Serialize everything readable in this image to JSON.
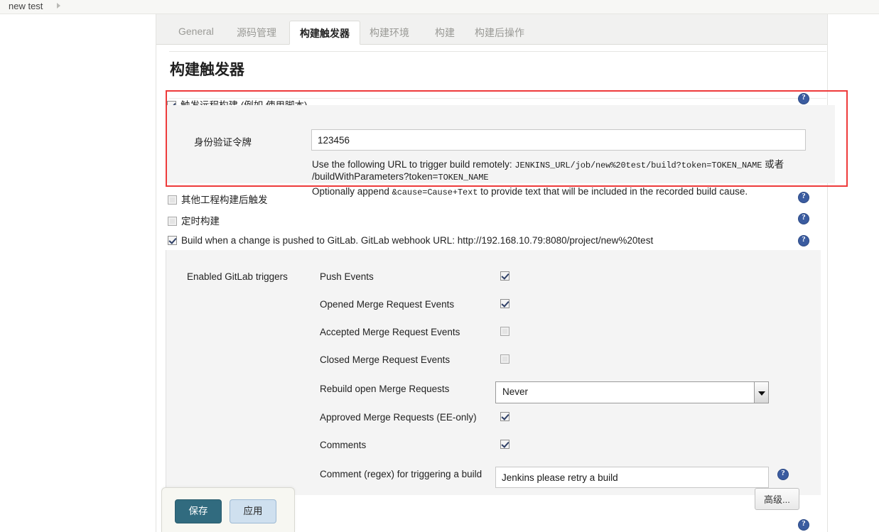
{
  "breadcrumb": {
    "item": "new test",
    "arrow_icon": "chevron-right-icon"
  },
  "tabs": [
    {
      "label": "General",
      "active": false
    },
    {
      "label": "源码管理",
      "active": false
    },
    {
      "label": "构建触发器",
      "active": true
    },
    {
      "label": "构建环境",
      "active": false
    },
    {
      "label": "构建",
      "active": false
    },
    {
      "label": "构建后操作",
      "active": false
    }
  ],
  "section": {
    "title": "构建触发器"
  },
  "remote_trigger": {
    "checkbox_label": "触发远程构建 (例如,使用脚本)",
    "checked": true,
    "highlighted": true,
    "highlight_color": "#ee3b3b",
    "token_label": "身份验证令牌",
    "token_value": "123456",
    "help_line1_a": "Use the following URL to trigger build remotely:",
    "help_line1_mono": "JENKINS_URL/job/new%20test/build?token=TOKEN_NAME",
    "help_line1_b": "或者",
    "help_line2_a": "/buildWithParameters?token=",
    "help_line2_mono": "TOKEN_NAME",
    "help_line3_a": "Optionally append",
    "help_line3_mono": "&cause=Cause+Text",
    "help_line3_b": "to provide text that will be included in the recorded build cause.",
    "help_icon": "help-icon"
  },
  "other_triggers": [
    {
      "label": "其他工程构建后触发",
      "checked": false,
      "help_icon": "help-icon"
    },
    {
      "label": "定时构建",
      "checked": false,
      "help_icon": "help-icon"
    },
    {
      "label": "Build when a change is pushed to GitLab. GitLab webhook URL: http://192.168.10.79:8080/project/new%20test",
      "checked": true,
      "help_icon": "help-icon"
    }
  ],
  "gitlab": {
    "section_label": "Enabled GitLab triggers",
    "events": [
      {
        "label": "Push Events",
        "checked": true
      },
      {
        "label": "Opened Merge Request Events",
        "checked": true
      },
      {
        "label": "Accepted Merge Request Events",
        "checked": false
      },
      {
        "label": "Closed Merge Request Events",
        "checked": false
      }
    ],
    "rebuild": {
      "label": "Rebuild open Merge Requests",
      "value": "Never",
      "dropdown_icon": "chevron-down-icon"
    },
    "approved": {
      "label": "Approved Merge Requests (EE-only)",
      "checked": true
    },
    "comments": {
      "label": "Comments",
      "checked": true
    },
    "comment_regex": {
      "label": "Comment (regex) for triggering a build",
      "value": "Jenkins please retry a build",
      "help_icon": "help-icon"
    },
    "advanced_button": "高级..."
  },
  "footer": {
    "save_label": "保存",
    "apply_label": "应用",
    "save_color": "#316b7f",
    "apply_color": "#cfe0ef",
    "help_icon": "help-icon"
  }
}
